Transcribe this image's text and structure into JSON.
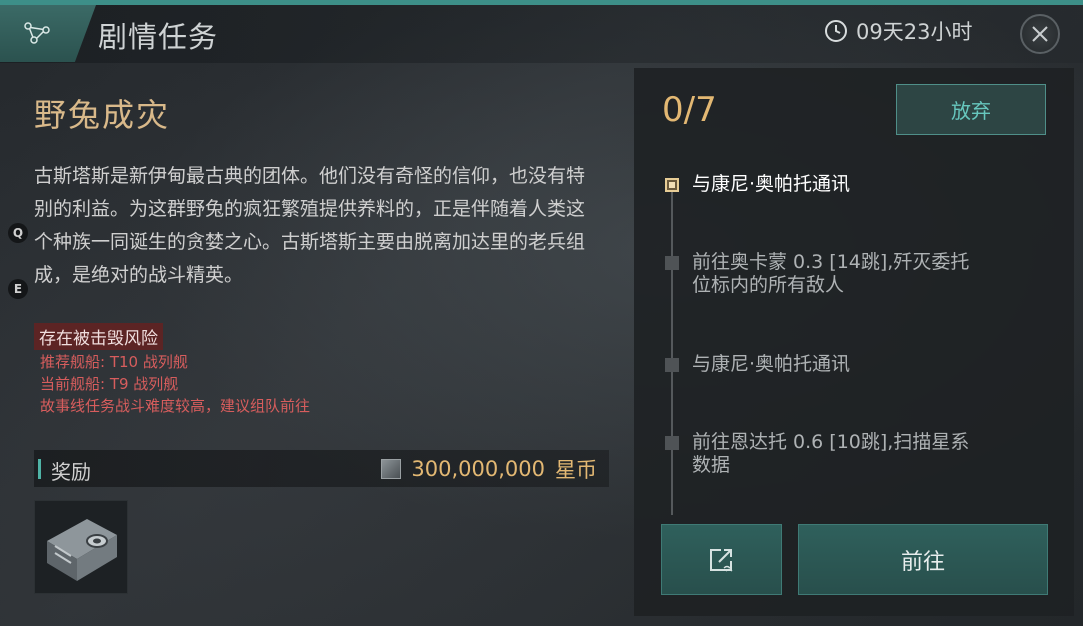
{
  "header": {
    "title": "剧情任务",
    "timer": "09天23小时",
    "icons": {
      "menu": "node-graph-icon",
      "clock": "clock-icon",
      "close": "close-icon"
    }
  },
  "mission": {
    "title": "野兔成灾",
    "description": "古斯塔斯是新伊甸最古典的团体。他们没有奇怪的信仰，也没有特别的利益。为这群野兔的疯狂繁殖提供养料的，正是伴随着人类这个种族一同诞生的贪婪之心。古斯塔斯主要由脱离加达里的老兵组成，是绝对的战斗精英。",
    "key_hints": [
      "Q",
      "E"
    ],
    "warning": {
      "badge": "存在被击毁风险",
      "lines": [
        "推荐舰船: T10 战列舰",
        "当前舰船: T9 战列舰",
        "故事线任务战斗难度较高，建议组队前往"
      ]
    },
    "reward": {
      "label": "奖励",
      "amount": "300,000,000",
      "currency": "星币",
      "item_icon": "cargo-container-icon"
    }
  },
  "objectives": {
    "progress": "0/7",
    "abandon_label": "放弃",
    "steps": [
      {
        "text": "与康尼·奥帕托通讯",
        "active": true
      },
      {
        "text": "前往奥卡蒙 0.3 [14跳],歼灭委托位标内的所有敌人",
        "active": false
      },
      {
        "text": "与康尼·奥帕托通讯",
        "active": false
      },
      {
        "text": "前往恩达托 0.6 [10跳],扫描星系数据",
        "active": false
      }
    ],
    "go_label": "前往",
    "share_icon": "share-link-icon"
  },
  "colors": {
    "accent_teal": "#3d8f88",
    "gold": "#e3b873",
    "warning_red": "#d75d5d"
  }
}
